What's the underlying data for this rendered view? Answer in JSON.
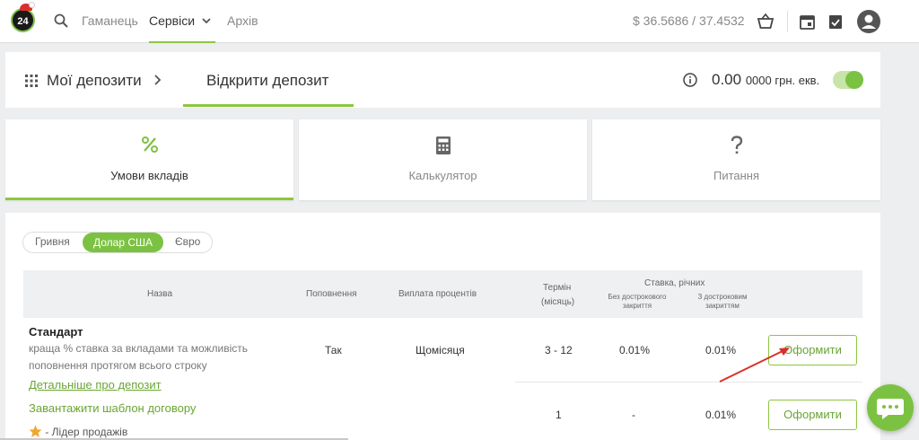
{
  "topbar": {
    "logo_text": "24",
    "nav": [
      "Гаманець",
      "Сервіси",
      "Архів"
    ],
    "rate": "$  36.5686 / 37.4532",
    "icons": [
      "search-icon",
      "chevron-down-icon",
      "basket-icon",
      "calendar-icon",
      "clipboard-icon",
      "avatar-icon"
    ]
  },
  "header": {
    "title": "Мої депозити",
    "active_tab": "Відкрити депозит",
    "balance_main": "0.00",
    "balance_rest": "0000 грн. екв."
  },
  "cards": [
    {
      "label": "Умови вкладів",
      "icon": "percent-icon",
      "active": true
    },
    {
      "label": "Калькулятор",
      "icon": "calculator-icon",
      "active": false
    },
    {
      "label": "Питання",
      "icon": "question-icon",
      "active": false
    }
  ],
  "currency_tabs": [
    "Гривня",
    "Долар США",
    "Євро"
  ],
  "table": {
    "headers": {
      "name": "Назва",
      "topup": "Поповнення",
      "payout": "Виплата процентів",
      "term_1": "Термін",
      "term_2": "(місяць)",
      "rate": "Ставка, річних",
      "rate_no_early_1": "Без дострокового",
      "rate_no_early_2": "закриття",
      "rate_early_1": "З достроковим",
      "rate_early_2": "закриттям"
    },
    "deposit": {
      "name": "Стандарт",
      "desc": "краща % ставка за вкладами та можливість поповнення протягом всього строку",
      "more_link": "Детальніше про депозит",
      "template_link": "Завантажити шаблон договору",
      "leader_label": "- Лідер продажів"
    },
    "rows": [
      {
        "topup": "Так",
        "payout": "Щомісяця",
        "term": "3 - 12",
        "rate_no_early": "0.01%",
        "rate_early": "0.01%",
        "button": "Оформити"
      },
      {
        "topup": "",
        "payout": "",
        "term": "1",
        "rate_no_early": "-",
        "rate_early": "0.01%",
        "button": "Оформити"
      }
    ]
  },
  "colors": {
    "accent": "#8dc63f",
    "arrow": "#d9312a"
  }
}
